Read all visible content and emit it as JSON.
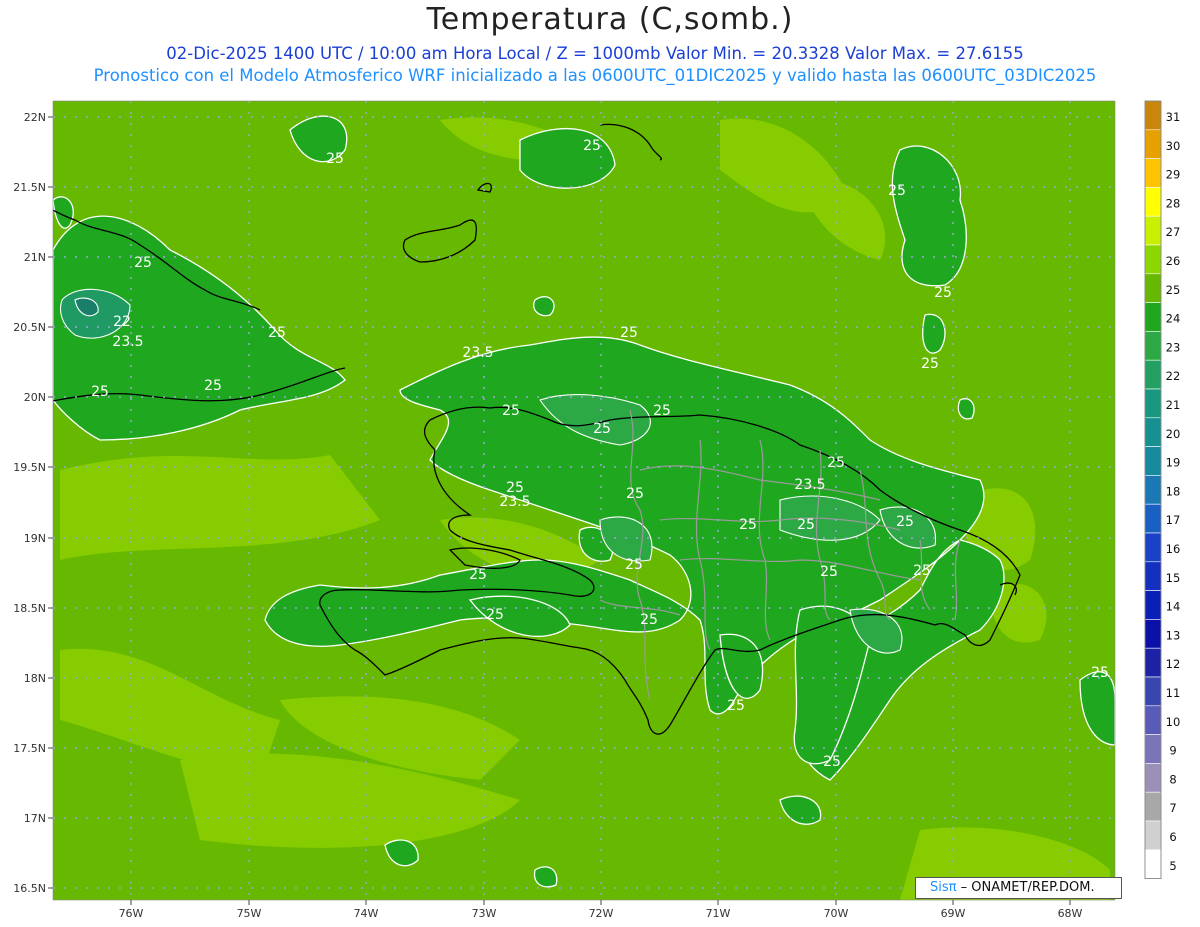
{
  "header": {
    "title": "Temperatura (C,somb.)",
    "subtitle_1": "02-Dic-2025 1400 UTC / 10:00 am Hora Local / Z = 1000mb  Valor Min. = 20.3328  Valor Max. = 27.6155",
    "subtitle_2": "Pronostico con el Modelo Atmosferico WRF inicializado a las 0600UTC_01DIC2025 y valido hasta las  0600UTC_03DIC2025"
  },
  "map": {
    "lat_ticks": [
      "22N",
      "21.5N",
      "21N",
      "20.5N",
      "20N",
      "19.5N",
      "19N",
      "18.5N",
      "18N",
      "17.5N",
      "17N",
      "16.5N"
    ],
    "lon_ticks": [
      "76W",
      "75W",
      "74W",
      "73W",
      "72W",
      "71W",
      "70W",
      "69W",
      "68W"
    ],
    "contour_labels": [
      "25",
      "25",
      "22",
      "23.5",
      "25",
      "25",
      "25",
      "25",
      "25",
      "25",
      "25",
      "25",
      "23.5",
      "25",
      "25",
      "25",
      "25",
      "23.5",
      "25",
      "23.5",
      "25",
      "25",
      "25",
      "25",
      "25",
      "25",
      "25",
      "25",
      "25",
      "25"
    ],
    "colors": {
      "background": "#66b800",
      "light_band": "#86cc00",
      "green_24": "#1fa81f",
      "green_23": "#2ca845",
      "teal_22": "#1e9a62"
    }
  },
  "colorbar": {
    "labels": [
      "31",
      "30",
      "29",
      "28",
      "27",
      "26",
      "25",
      "24",
      "23",
      "22",
      "21",
      "20",
      "19",
      "18",
      "17",
      "16",
      "15",
      "14",
      "13",
      "12",
      "11",
      "10",
      "9",
      "8",
      "7",
      "6",
      "5"
    ],
    "colors": [
      "#c8860a",
      "#e6a000",
      "#ffc400",
      "#ffff00",
      "#c8f000",
      "#8ed600",
      "#66b800",
      "#1fa81f",
      "#2ca845",
      "#22a061",
      "#1a977f",
      "#169090",
      "#168a9d",
      "#1a78b5",
      "#1a5fc4",
      "#1a42c8",
      "#1430c0",
      "#0a1fb8",
      "#0a10a8",
      "#1c22a6",
      "#3a46b0",
      "#5a5ab8",
      "#7b74b8",
      "#9a90b8",
      "#a8a8a8",
      "#d0d0d0",
      "#ffffff"
    ]
  },
  "credit": {
    "brand": "Sisπ",
    "text": " – ONAMET/REP.DOM."
  }
}
